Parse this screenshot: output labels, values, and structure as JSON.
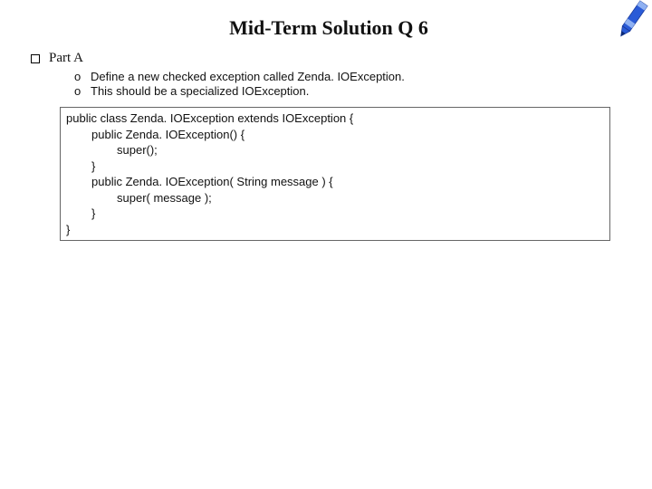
{
  "title": "Mid-Term Solution Q 6",
  "part": {
    "label": "Part A",
    "items": [
      "Define a new checked exception called Zenda. IOException.",
      "This should be a specialized IOException."
    ]
  },
  "code": {
    "l0": "public class Zenda. IOException extends IOException {",
    "l1": "public Zenda. IOException() {",
    "l2": "super();",
    "l3": "}",
    "l4": "public Zenda. IOException( String message ) {",
    "l5": "super( message );",
    "l6": "}",
    "l7": "}"
  }
}
